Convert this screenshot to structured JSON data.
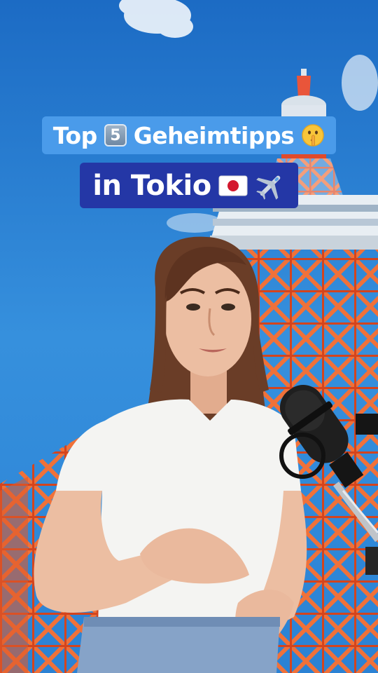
{
  "caption": {
    "line1": {
      "text_before": "Top",
      "number_badge": "5",
      "text_after": "Geheimtipps",
      "emoji_icon": "shushing-face-icon"
    },
    "line2": {
      "text": "in Tokio",
      "emoji_icons": [
        "japan-flag-icon",
        "airplane-icon"
      ]
    }
  },
  "colors": {
    "sky": "#2a80d2",
    "caption_line1_bg": "#4a9bea",
    "caption_line2_bg": "#2437a6",
    "tower_red": "#e2532a",
    "tower_white": "#eef2f5",
    "shirt": "#f4f4f2",
    "hair": "#6a3d27",
    "skin": "#e9b99c",
    "jeans": "#7f9cc3",
    "microphone": "#1c1c1c"
  }
}
